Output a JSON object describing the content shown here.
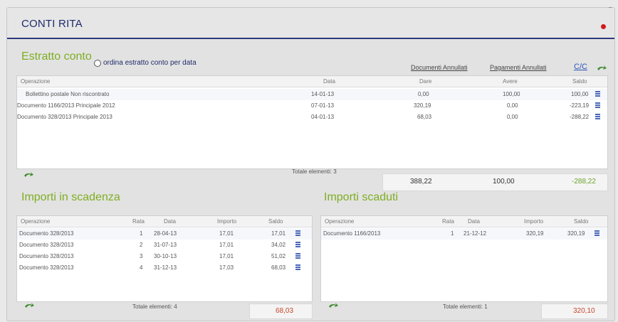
{
  "page": {
    "title": "CONTI RITA",
    "top_right_label": "g"
  },
  "estratto": {
    "title": "Estratto conto",
    "radio_label": "ordina estratto conto per data",
    "link_documenti": "Documenti Annullati",
    "link_pagamenti": "Pagamenti Annullati",
    "link_cc": "C/C",
    "columns": [
      "Operazione",
      "Data",
      "Dare",
      "Avere",
      "Saldo"
    ],
    "rows": [
      {
        "op": "Bollettino postale Non riscontrato",
        "data": "14-01-13",
        "dare": "0,00",
        "avere": "100,00",
        "saldo": "100,00"
      },
      {
        "op": "Documento 1166/2013 Principale 2012",
        "data": "07-01-13",
        "dare": "320,19",
        "avere": "0,00",
        "saldo": "-223,19"
      },
      {
        "op": "Documento 328/2013 Principale 2013",
        "data": "04-01-13",
        "dare": "68,03",
        "avere": "0,00",
        "saldo": "-288,22"
      }
    ],
    "total_elements": "Totale elementi: 3",
    "totals": {
      "dare": "388,22",
      "avere": "100,00",
      "saldo": "-288,22"
    }
  },
  "scadenza": {
    "title": "Importi in scadenza",
    "columns": [
      "Operazione",
      "Rata",
      "Data",
      "Importo",
      "Saldo"
    ],
    "rows": [
      {
        "op": "Documento 328/2013",
        "rata": "1",
        "data": "28-04-13",
        "importo": "17,01",
        "saldo": "17,01"
      },
      {
        "op": "Documento 328/2013",
        "rata": "2",
        "data": "31-07-13",
        "importo": "17,01",
        "saldo": "34,02"
      },
      {
        "op": "Documento 328/2013",
        "rata": "3",
        "data": "30-10-13",
        "importo": "17,01",
        "saldo": "51,02"
      },
      {
        "op": "Documento 328/2013",
        "rata": "4",
        "data": "31-12-13",
        "importo": "17,03",
        "saldo": "68,03"
      }
    ],
    "total_elements": "Totale elementi: 4",
    "total": "68,03"
  },
  "scaduti": {
    "title": "Importi scaduti",
    "columns": [
      "Operazione",
      "Rata",
      "Data",
      "Importo",
      "Saldo"
    ],
    "rows": [
      {
        "op": "Documento 1166/2013",
        "rata": "1",
        "data": "21-12-12",
        "importo": "320,19",
        "saldo": "320,19"
      }
    ],
    "total_elements": "Totale elementi: 1",
    "total": "320,10"
  }
}
